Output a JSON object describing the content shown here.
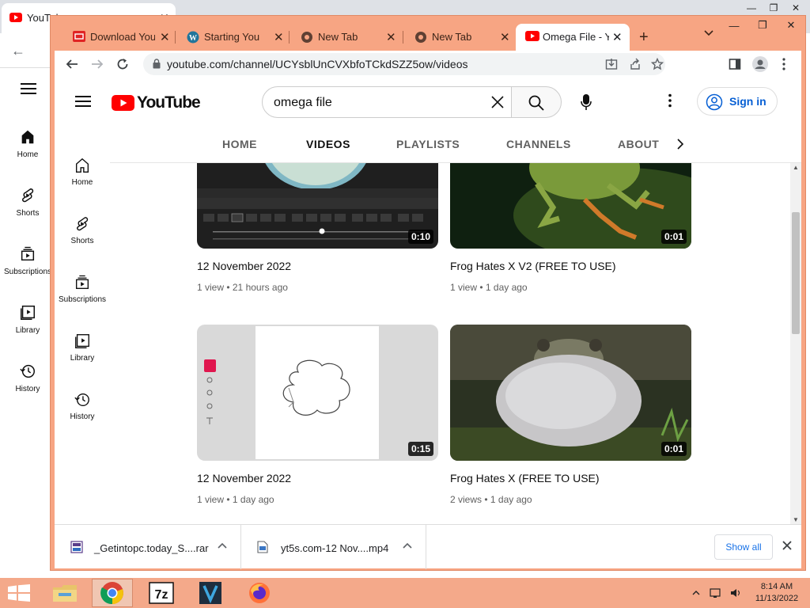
{
  "background_window": {
    "tab_title": "YouTube",
    "sidebar": [
      {
        "label": "Home",
        "icon": "home-icon"
      },
      {
        "label": "Shorts",
        "icon": "shorts-icon"
      },
      {
        "label": "Subscriptions",
        "icon": "subscriptions-icon"
      },
      {
        "label": "Library",
        "icon": "library-icon"
      },
      {
        "label": "History",
        "icon": "history-icon"
      }
    ]
  },
  "tabs": [
    {
      "title": "Download YouTube",
      "favicon": "download-favicon"
    },
    {
      "title": "Starting Your Digital",
      "favicon": "wordpress-favicon"
    },
    {
      "title": "New Tab",
      "favicon": "chrome-favicon"
    },
    {
      "title": "New Tab",
      "favicon": "chrome-favicon"
    },
    {
      "title": "Omega File - YouTube",
      "favicon": "youtube-favicon",
      "active": true
    }
  ],
  "address_bar": {
    "url": "youtube.com/channel/UCYsblUnCVXbfoTCkdSZZ5ow/videos"
  },
  "youtube": {
    "logo_text": "YouTube",
    "search_value": "omega file",
    "sign_in": "Sign in",
    "channel_tabs": [
      "HOME",
      "VIDEOS",
      "PLAYLISTS",
      "CHANNELS",
      "ABOUT"
    ],
    "active_tab": "VIDEOS",
    "sidebar": [
      {
        "label": "Home"
      },
      {
        "label": "Shorts"
      },
      {
        "label": "Subscriptions"
      },
      {
        "label": "Library"
      },
      {
        "label": "History"
      }
    ],
    "videos": [
      {
        "title": "12 November 2022",
        "meta": "1 view • 21 hours ago",
        "duration": "0:10"
      },
      {
        "title": "Frog Hates X V2 (FREE TO USE)",
        "meta": "1 view • 1 day ago",
        "duration": "0:01"
      },
      {
        "title": "12 November 2022",
        "meta": "1 view • 1 day ago",
        "duration": "0:15"
      },
      {
        "title": "Frog Hates X (FREE TO USE)",
        "meta": "2 views • 1 day ago",
        "duration": "0:01"
      }
    ]
  },
  "downloads": {
    "items": [
      {
        "name": "_Getintopc.today_S....rar"
      },
      {
        "name": "yt5s.com-12 Nov....mp4"
      }
    ],
    "show_all": "Show all"
  },
  "taskbar": {
    "time": "8:14 AM",
    "date": "11/13/2022"
  },
  "colors": {
    "youtube_red": "#ff0000",
    "link_blue": "#065fd4",
    "window_frame": "#f7a583"
  }
}
